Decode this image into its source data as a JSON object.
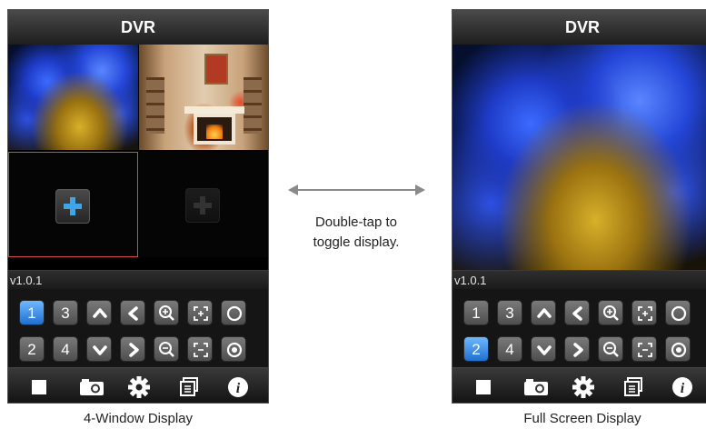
{
  "left_phone": {
    "title": "DVR",
    "version": "v1.0.1",
    "channel_buttons": [
      "1",
      "3",
      "2",
      "4"
    ],
    "selected_channel": "1",
    "caption": "4-Window Display"
  },
  "right_phone": {
    "title": "DVR",
    "version": "v1.0.1",
    "channel_buttons": [
      "1",
      "3",
      "2",
      "4"
    ],
    "selected_channel": "2",
    "caption": "Full Screen Display"
  },
  "hint": {
    "line1": "Double-tap to",
    "line2": "toggle display."
  },
  "colors": {
    "selected_button": "#2a7fe0",
    "add_plus": "#3fa4e8",
    "active_cell_border": "#d84a4a"
  },
  "icons": {
    "ptz_up": "chevron-up-icon",
    "ptz_down": "chevron-down-icon",
    "ptz_left": "chevron-left-icon",
    "ptz_right": "chevron-right-icon",
    "zoom_in": "zoom-in-icon",
    "zoom_out": "zoom-out-icon",
    "focus_near": "focus-in-icon",
    "focus_far": "focus-out-icon",
    "iris_open": "iris-open-icon",
    "iris_close": "iris-close-icon",
    "stop": "stop-icon",
    "snapshot": "camera-icon",
    "settings": "gear-icon",
    "gallery": "gallery-icon",
    "info": "info-icon"
  }
}
